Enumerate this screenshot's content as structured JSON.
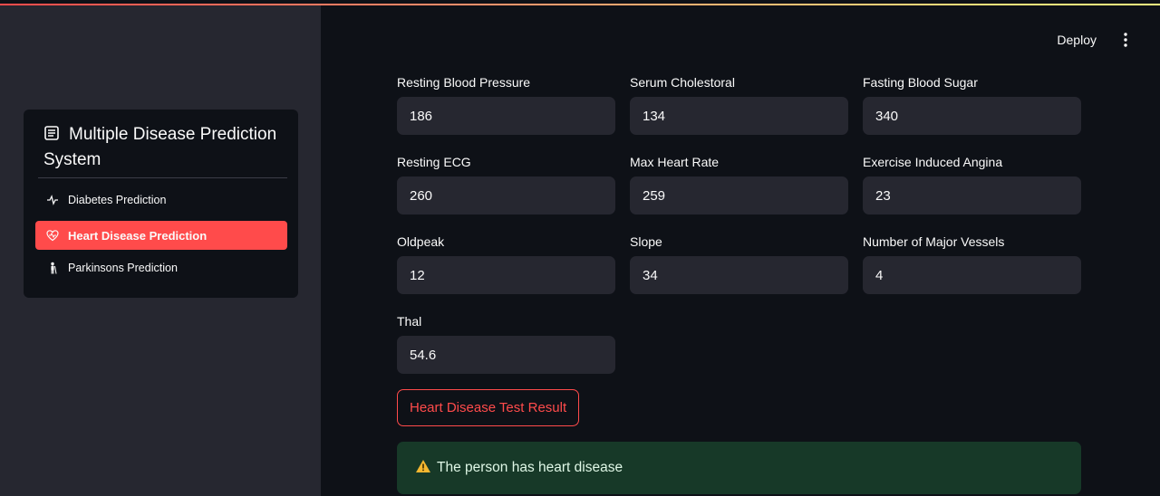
{
  "header": {
    "deploy_label": "Deploy"
  },
  "sidebar": {
    "menu_title": "Multiple Disease Prediction System",
    "items": [
      {
        "label": "Diabetes Prediction",
        "icon": "activity-icon",
        "active": false
      },
      {
        "label": "Heart Disease Prediction",
        "icon": "heart-pulse-icon",
        "active": true
      },
      {
        "label": "Parkinsons Prediction",
        "icon": "person-icon",
        "active": false
      }
    ]
  },
  "form": {
    "fields": [
      {
        "label": "Resting Blood Pressure",
        "value": "186"
      },
      {
        "label": "Serum Cholestoral",
        "value": "134"
      },
      {
        "label": "Fasting Blood Sugar",
        "value": "340"
      },
      {
        "label": "Resting ECG",
        "value": "260"
      },
      {
        "label": "Max Heart Rate",
        "value": "259"
      },
      {
        "label": "Exercise Induced Angina",
        "value": "23"
      },
      {
        "label": "Oldpeak",
        "value": "12"
      },
      {
        "label": "Slope",
        "value": "34"
      },
      {
        "label": "Number of Major Vessels",
        "value": "4"
      },
      {
        "label": "Thal",
        "value": "54.6"
      }
    ],
    "submit_label": "Heart Disease Test Result"
  },
  "result": {
    "message": "The person has heart disease",
    "icon": "warning-icon"
  },
  "colors": {
    "accent": "#ff4b4b",
    "background": "#0e1117",
    "sidebar": "#262730",
    "input": "#262730",
    "result_bg": "#173928"
  }
}
